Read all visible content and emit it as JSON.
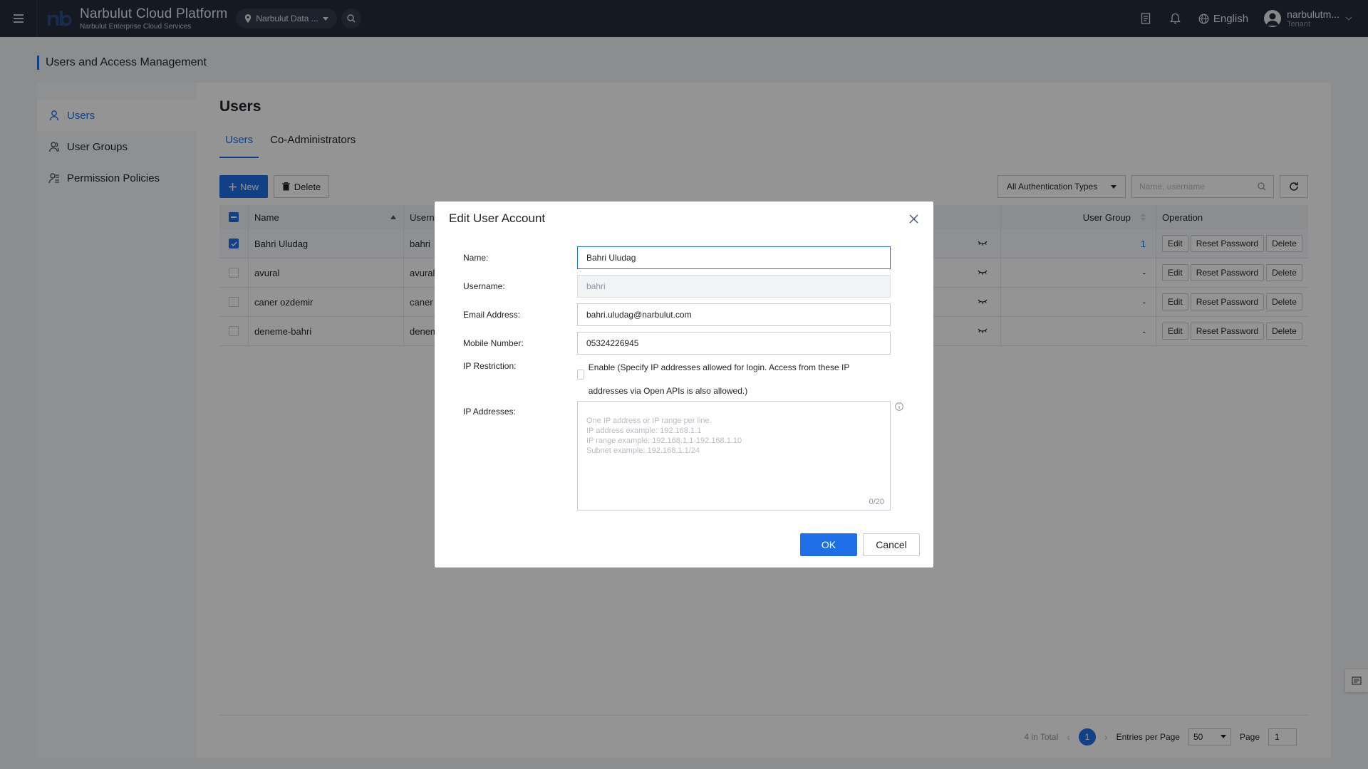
{
  "topbar": {
    "brand_title": "Narbulut Cloud Platform",
    "brand_subtitle": "Narbulut Enterprise Cloud Services",
    "region": "Narbulut Data ...",
    "language": "English",
    "user_name": "narbulutm...",
    "user_role": "Tenant"
  },
  "page": {
    "title": "Users and Access Management"
  },
  "sidebar": {
    "items": [
      {
        "label": "Users",
        "icon": "user-icon",
        "active": true
      },
      {
        "label": "User Groups",
        "icon": "user-group-icon",
        "active": false
      },
      {
        "label": "Permission Policies",
        "icon": "permission-policy-icon",
        "active": false
      }
    ]
  },
  "main": {
    "title": "Users",
    "tabs": [
      {
        "label": "Users"
      },
      {
        "label": "Co-Administrators"
      }
    ],
    "toolbar": {
      "new_label": "New",
      "delete_label": "Delete",
      "auth_filter": "All Authentication Types",
      "search_placeholder": "Name, username"
    },
    "table": {
      "headers": {
        "name": "Name",
        "username": "Userna",
        "user_group": "User Group",
        "operation": "Operation"
      },
      "rows": [
        {
          "name": "Bahri Uludag",
          "username": "bahri",
          "user_group": "1",
          "selected": true
        },
        {
          "name": "avural",
          "username": "avural",
          "user_group": "-",
          "selected": false
        },
        {
          "name": "caner ozdemir",
          "username": "caner",
          "user_group": "-",
          "selected": false
        },
        {
          "name": "deneme-bahri",
          "username": "denem",
          "user_group": "-",
          "selected": false
        }
      ],
      "ops": {
        "edit": "Edit",
        "reset": "Reset Password",
        "delete": "Delete"
      }
    },
    "pager": {
      "total": "4 in Total",
      "current_page": "1",
      "entries_label": "Entries per Page",
      "entries_value": "50",
      "page_label": "Page",
      "page_value": "1"
    }
  },
  "dialog": {
    "title": "Edit User Account",
    "labels": {
      "name": "Name:",
      "username": "Username:",
      "email": "Email Address:",
      "mobile": "Mobile Number:",
      "ip_restriction": "IP Restriction:",
      "ip_addresses": "IP Addresses:"
    },
    "values": {
      "name": "Bahri Uludag",
      "username": "bahri",
      "email": "bahri.uludag@narbulut.com",
      "mobile": "05324226945"
    },
    "ip_enable_text": "Enable (Specify IP addresses allowed for login. Access from these IP addresses via Open APIs is also allowed.)",
    "ip_placeholder": "One IP address or IP range per line.\nIP address example: 192.168.1.1\nIP range example: 192.168.1.1-192.168.1.10\nSubnet example: 192.168.1.1/24",
    "ip_count": "0/20",
    "ok_label": "OK",
    "cancel_label": "Cancel"
  },
  "colors": {
    "accent": "#1e6fe8",
    "topbar": "#252b3a"
  }
}
